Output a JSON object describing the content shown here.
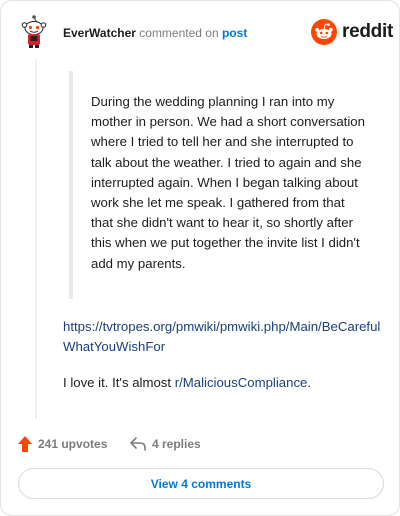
{
  "header": {
    "author": "EverWatcher",
    "action": "commented on",
    "post_link": "post",
    "logo_text": "reddit"
  },
  "comment": {
    "quote": "During the wedding planning I ran into my mother in person. We had a short conversation where I tried to tell her and she interrupted to talk about the weather. I tried to again and she interrupted again. When I began talking about work she let me speak. I gathered from that that she didn't want to hear it, so shortly after this when we put together the invite list I didn't add my parents.",
    "link": "https://tvtropes.org/pmwiki/pmwiki.php/Main/BeCarefulWhatYouWishFor",
    "text_before": "I love it. It's almost ",
    "subreddit": "r/MaliciousCompliance",
    "text_after": "."
  },
  "footer": {
    "upvotes": "241 upvotes",
    "replies": "4 replies",
    "view_comments": "View 4 comments"
  },
  "colors": {
    "upvote": "#ff4500",
    "link": "#0079d3",
    "reddit_orange": "#ff4500"
  }
}
